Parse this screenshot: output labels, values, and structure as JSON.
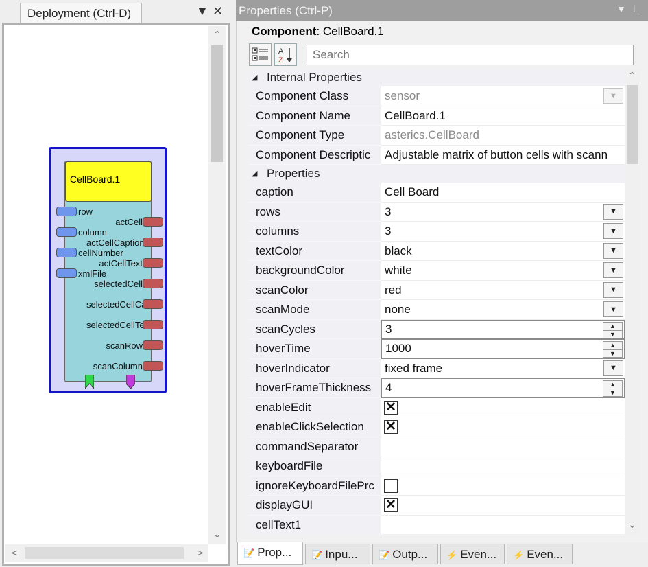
{
  "deployment": {
    "tab_title": "Deployment (Ctrl-D)",
    "component": {
      "title": "CellBoard.1",
      "inputs": [
        "row",
        "column",
        "cellNumber",
        "xmlFile"
      ],
      "outputs": [
        "actCell",
        "actCellCaption",
        "actCellText",
        "selectedCell",
        "selectedCellCaption",
        "selectedCellText",
        "scanRow",
        "scanColumn"
      ],
      "colors": {
        "outer": "#d7d7f9",
        "body": "#98d4dc",
        "title": "#ffff22",
        "input_port": "#6d96ec",
        "output_port": "#c25656",
        "event_in": "#2fd84a",
        "event_out": "#c13cdb"
      }
    }
  },
  "properties": {
    "header_title": "Properties (Ctrl-P)",
    "component_label": "Component",
    "component_value": "CellBoard.1",
    "search_placeholder": "Search",
    "internal_category": "Internal Properties",
    "internal": [
      {
        "name": "Component Class",
        "value": "sensor"
      },
      {
        "name": "Component Name",
        "value": "CellBoard.1"
      },
      {
        "name": "Component Type",
        "value": "asterics.CellBoard"
      },
      {
        "name": "Component Descriptic",
        "value": "Adjustable matrix of button cells with scann"
      }
    ],
    "properties_category": "Properties",
    "props": [
      {
        "name": "caption",
        "value": "Cell Board"
      },
      {
        "name": "rows",
        "value": "3"
      },
      {
        "name": "columns",
        "value": "3"
      },
      {
        "name": "textColor",
        "value": "black"
      },
      {
        "name": "backgroundColor",
        "value": "white"
      },
      {
        "name": "scanColor",
        "value": "red"
      },
      {
        "name": "scanMode",
        "value": "none"
      },
      {
        "name": "scanCycles",
        "value": "3"
      },
      {
        "name": "hoverTime",
        "value": "1000"
      },
      {
        "name": "hoverIndicator",
        "value": "fixed frame"
      },
      {
        "name": "hoverFrameThickness",
        "value": "4"
      },
      {
        "name": "enableEdit",
        "checked": true
      },
      {
        "name": "enableClickSelection",
        "checked": true
      },
      {
        "name": "commandSeparator",
        "value": ""
      },
      {
        "name": "keyboardFile",
        "value": ""
      },
      {
        "name": "ignoreKeyboardFilePrc",
        "checked": false
      },
      {
        "name": "displayGUI",
        "checked": true
      },
      {
        "name": "cellText1",
        "value": ""
      }
    ]
  },
  "bottom_tabs": [
    "Prop...",
    "Inpu...",
    "Outp...",
    "Even...",
    "Even..."
  ]
}
